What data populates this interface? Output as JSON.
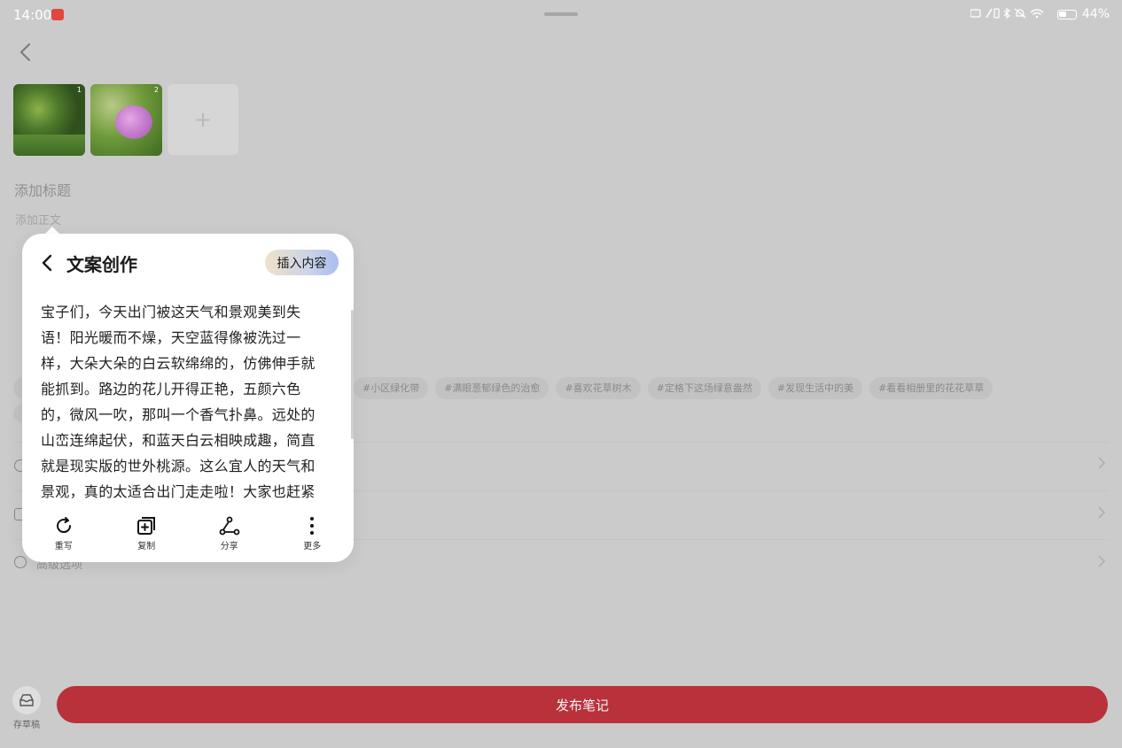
{
  "status_bar": {
    "time": "14:00",
    "battery": "44%"
  },
  "thumbnails": [
    {
      "index": "1"
    },
    {
      "index": "2"
    }
  ],
  "add_photo_symbol": "+",
  "editor": {
    "title_placeholder": "添加标题",
    "body_placeholder": "添加正文"
  },
  "tags": [
    "#小区绿化带",
    "#满眼葱郁绿色的治愈",
    "#喜欢花草树木",
    "#定格下这场绿意盎然",
    "#发现生活中的美",
    "#看看相册里的花花草草"
  ],
  "settings": {
    "advanced_label": "高级选项"
  },
  "popup": {
    "title": "文案创作",
    "insert_label": "插入内容",
    "content": "宝子们，今天出门被这天气和景观美到失语！阳光暖而不燥，天空蓝得像被洗过一样，大朵大朵的白云软绵绵的，仿佛伸手就能抓到。路边的花儿开得正艳，五颜六色的，微风一吹，那叫一个香气扑鼻。远处的山峦连绵起伏，和蓝天白云相映成趣，简直就是现实版的世外桃源。这么宜人的天气和景观，真的太适合出门走走啦！大家也赶紧",
    "actions": [
      {
        "label": "重写",
        "icon": "refresh-icon"
      },
      {
        "label": "复制",
        "icon": "copy-icon"
      },
      {
        "label": "分享",
        "icon": "share-icon"
      },
      {
        "label": "更多",
        "icon": "more-icon"
      }
    ]
  },
  "bottom": {
    "draft_label": "存草稿",
    "publish_label": "发布笔记"
  },
  "colors": {
    "background": "#cbcbcb",
    "publish": "#b9313b",
    "popup": "#ffffff"
  }
}
